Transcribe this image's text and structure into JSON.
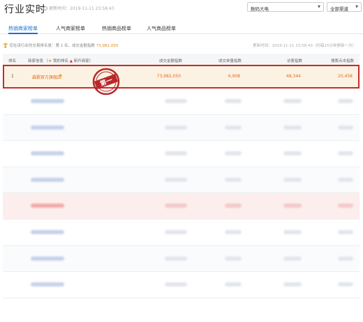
{
  "header": {
    "title": "行业实时",
    "update_time": "更新时间：2019-11-11 23:58:43",
    "category_select": "数码大电",
    "channel_select": "全部渠道"
  },
  "tabs": [
    "热销商家榜单",
    "人气商家榜单",
    "热销商品榜单",
    "人气商品榜单"
  ],
  "active_tab": 0,
  "info_bar": {
    "text_prefix": "您在该行业的交易排名是：第 1 名，成交金额指数",
    "text_value": "73,982,050",
    "update_right": "更新时间：2019-11-11 23:58:43（约每15分钟更新一次）"
  },
  "table": {
    "headers": {
      "rank": "排名",
      "shop": "商家信息",
      "my_rank": "我的排名",
      "rising": "新升商家",
      "sales_index": "成交金额指数",
      "volume_index": "成交单量指数",
      "visit_index": "访客指数",
      "search_index": "搜索点击指数"
    },
    "first_row": {
      "rank": "1",
      "shop": "森歌官方旗舰店",
      "sales_index": "73,982,050",
      "volume_index": "6,908",
      "visit_index": "48,344",
      "search_index": "20,458"
    },
    "stamp_text": "第一"
  },
  "colors": {
    "accent": "#1a6fd3",
    "highlight_border": "#c92b2b",
    "highlight_bg": "#fcf2e3",
    "value_orange": "#e46a1a"
  }
}
